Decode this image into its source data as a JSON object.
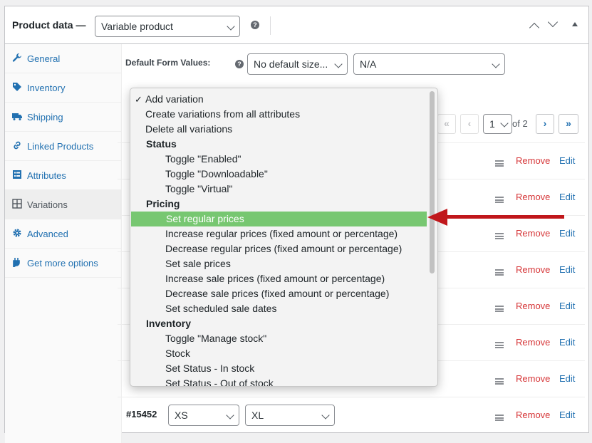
{
  "header": {
    "title": "Product data —",
    "product_type": "Variable product"
  },
  "sidebar": {
    "items": [
      {
        "label": "General"
      },
      {
        "label": "Inventory"
      },
      {
        "label": "Shipping"
      },
      {
        "label": "Linked Products"
      },
      {
        "label": "Attributes"
      },
      {
        "label": "Variations"
      },
      {
        "label": "Advanced"
      },
      {
        "label": "Get more options"
      }
    ]
  },
  "defaults": {
    "label": "Default Form Values:",
    "size_value": "No default size...",
    "second_value": "N/A"
  },
  "pagination": {
    "first": "«",
    "prev": "‹",
    "current_page": "1",
    "of_label": "of 2",
    "next": "›",
    "last": "»"
  },
  "variation_actions": {
    "remove_label": "Remove",
    "edit_label": "Edit",
    "last_row": {
      "id": "#15452",
      "size": "XS",
      "color": "XL"
    }
  },
  "dropdown": {
    "checkmark": "✓",
    "items": [
      {
        "text": "Add variation",
        "kind": "top",
        "selected": true
      },
      {
        "text": "Create variations from all attributes",
        "kind": "top"
      },
      {
        "text": "Delete all variations",
        "kind": "top"
      },
      {
        "text": "Status",
        "kind": "group"
      },
      {
        "text": "Toggle \"Enabled\"",
        "kind": "option"
      },
      {
        "text": "Toggle \"Downloadable\"",
        "kind": "option"
      },
      {
        "text": "Toggle \"Virtual\"",
        "kind": "option"
      },
      {
        "text": "Pricing",
        "kind": "group"
      },
      {
        "text": "Set regular prices",
        "kind": "option",
        "highlighted": true
      },
      {
        "text": "Increase regular prices (fixed amount or percentage)",
        "kind": "option"
      },
      {
        "text": "Decrease regular prices (fixed amount or percentage)",
        "kind": "option"
      },
      {
        "text": "Set sale prices",
        "kind": "option"
      },
      {
        "text": "Increase sale prices (fixed amount or percentage)",
        "kind": "option"
      },
      {
        "text": "Decrease sale prices (fixed amount or percentage)",
        "kind": "option"
      },
      {
        "text": "Set scheduled sale dates",
        "kind": "option"
      },
      {
        "text": "Inventory",
        "kind": "group"
      },
      {
        "text": "Toggle \"Manage stock\"",
        "kind": "option"
      },
      {
        "text": "Stock",
        "kind": "option"
      },
      {
        "text": "Set Status - In stock",
        "kind": "option"
      },
      {
        "text": "Set Status - Out of stock",
        "kind": "option"
      }
    ]
  },
  "colors": {
    "link": "#2271b1",
    "remove": "#d63638",
    "highlight": "#77c771",
    "annotation_arrow": "#c0171b"
  },
  "icons": [
    "wrench-icon",
    "tag-icon",
    "truck-icon",
    "link-icon",
    "list-icon",
    "grid-icon",
    "gear-icon",
    "plug-icon",
    "help-icon",
    "chevron-down-icon"
  ]
}
